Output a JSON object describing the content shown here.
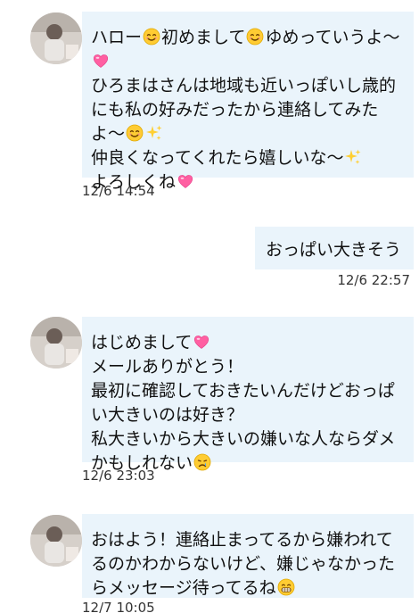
{
  "messages": [
    {
      "direction": "incoming",
      "segments": [
        {
          "t": "text",
          "v": "ハロー"
        },
        {
          "t": "icon",
          "v": "smile-emoji"
        },
        {
          "t": "text",
          "v": "初めまして"
        },
        {
          "t": "icon",
          "v": "smile-emoji"
        },
        {
          "t": "text",
          "v": "ゆめっていうよ〜"
        },
        {
          "t": "icon",
          "v": "heart-emoji"
        },
        {
          "t": "text",
          "v": "\nひろまはさんは地域も近いっぽいし歳的にも私の好みだったから連絡してみたよ〜"
        },
        {
          "t": "icon",
          "v": "smile-emoji"
        },
        {
          "t": "icon",
          "v": "sparkles-emoji"
        },
        {
          "t": "text",
          "v": "\n仲良くなってくれたら嬉しいな〜"
        },
        {
          "t": "icon",
          "v": "sparkles-emoji"
        },
        {
          "t": "text",
          "v": "\nよろしくね"
        },
        {
          "t": "icon",
          "v": "heart-emoji"
        }
      ],
      "time": "12/6 14:54"
    },
    {
      "direction": "outgoing",
      "segments": [
        {
          "t": "text",
          "v": "おっぱい大きそう"
        }
      ],
      "time": "12/6 22:57"
    },
    {
      "direction": "incoming",
      "segments": [
        {
          "t": "text",
          "v": "はじめまして"
        },
        {
          "t": "icon",
          "v": "heart-emoji"
        },
        {
          "t": "text",
          "v": "\nメールありがとう！\n最初に確認しておきたいんだけどおっぱい大きいのは好き？\n私大きいから大きいの嫌いな人ならダメかもしれない"
        },
        {
          "t": "icon",
          "v": "crying-emoji"
        }
      ],
      "time": "12/6 23:03"
    },
    {
      "direction": "incoming",
      "segments": [
        {
          "t": "text",
          "v": "おはよう！連絡止まってるから嫌われてるのかわからないけど、嫌じゃなかったらメッセージ待ってるね"
        },
        {
          "t": "icon",
          "v": "grin-emoji"
        }
      ],
      "time": "12/7 10:05"
    }
  ],
  "colors": {
    "bubble": "#eaf4fb",
    "text": "#111111",
    "time": "#333333"
  }
}
